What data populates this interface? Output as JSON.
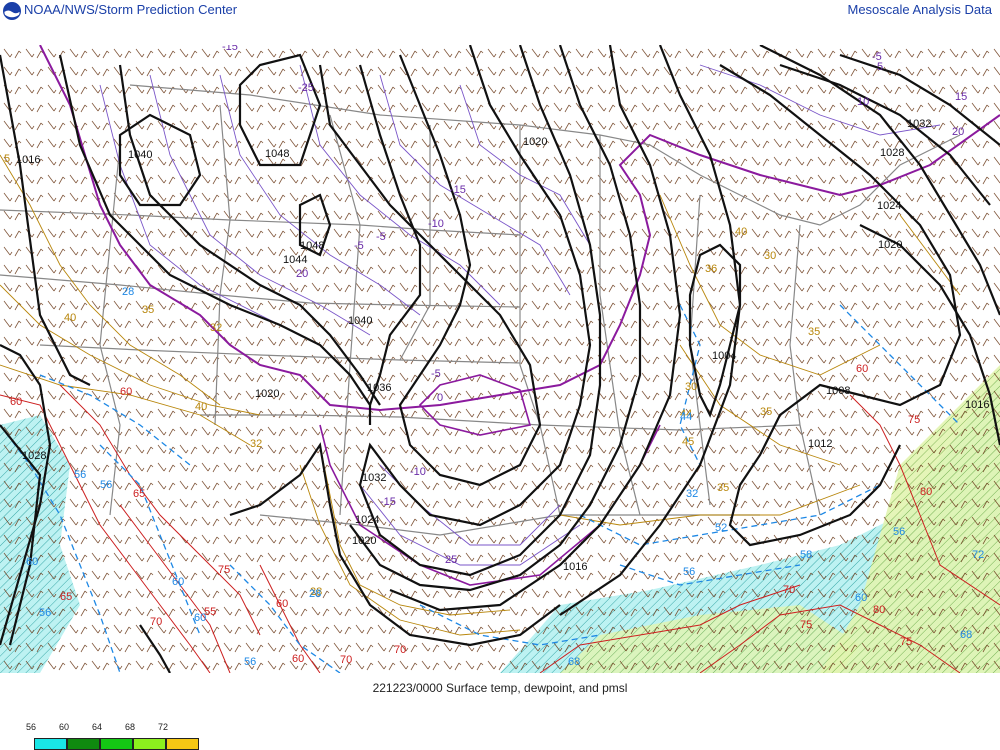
{
  "header": {
    "left_title": "NOAA/NWS/Storm Prediction Center",
    "right_title": "Mesoscale Analysis Data"
  },
  "caption": "221223/0000 Surface temp, dewpoint, and pmsl",
  "legend": {
    "labels": [
      "56",
      "60",
      "64",
      "68",
      "72"
    ],
    "colors": [
      "#19e6e6",
      "#0f8a0f",
      "#14c814",
      "#8cf01e",
      "#f5c814"
    ]
  },
  "colors": {
    "isobar": "#111111",
    "temp_freezing": "#8b1a9e",
    "temp_cold": "#7a55c8",
    "temp_mild": "#b8860b",
    "temp_warm": "#cc1f1f",
    "dewpoint": "#1e88e5",
    "borders": "#888888",
    "barbs": "#6b3a1a"
  },
  "isobar_labels": [
    "1016",
    "1040",
    "1048",
    "1048",
    "1044",
    "1040",
    "1036",
    "1020",
    "1020",
    "1032",
    "1028",
    "1024",
    "1020",
    "1004",
    "1008",
    "1012",
    "1016",
    "1028",
    "1024",
    "1032",
    "1020",
    "1016"
  ],
  "temp_labels": {
    "cold": [
      "-15",
      "-25",
      "-5",
      "-15",
      "-5",
      "-10",
      "-5",
      "-10",
      "-15",
      "-5",
      "0",
      "0",
      "5",
      "10",
      "15",
      "20",
      "25",
      "20"
    ],
    "mild": [
      "5",
      "40",
      "40",
      "35",
      "40",
      "35",
      "30",
      "36",
      "32",
      "30",
      "35",
      "35",
      "32",
      "44",
      "45",
      "28"
    ],
    "warm": [
      "60",
      "60",
      "65",
      "75",
      "80",
      "75",
      "70",
      "70",
      "65",
      "60",
      "55",
      "60",
      "70",
      "75",
      "80",
      "75",
      "70",
      "60"
    ],
    "dew": [
      "28",
      "56",
      "56",
      "60",
      "56",
      "60",
      "60",
      "28",
      "56",
      "44",
      "32",
      "56",
      "52",
      "68",
      "58",
      "60",
      "56",
      "68",
      "72"
    ]
  }
}
